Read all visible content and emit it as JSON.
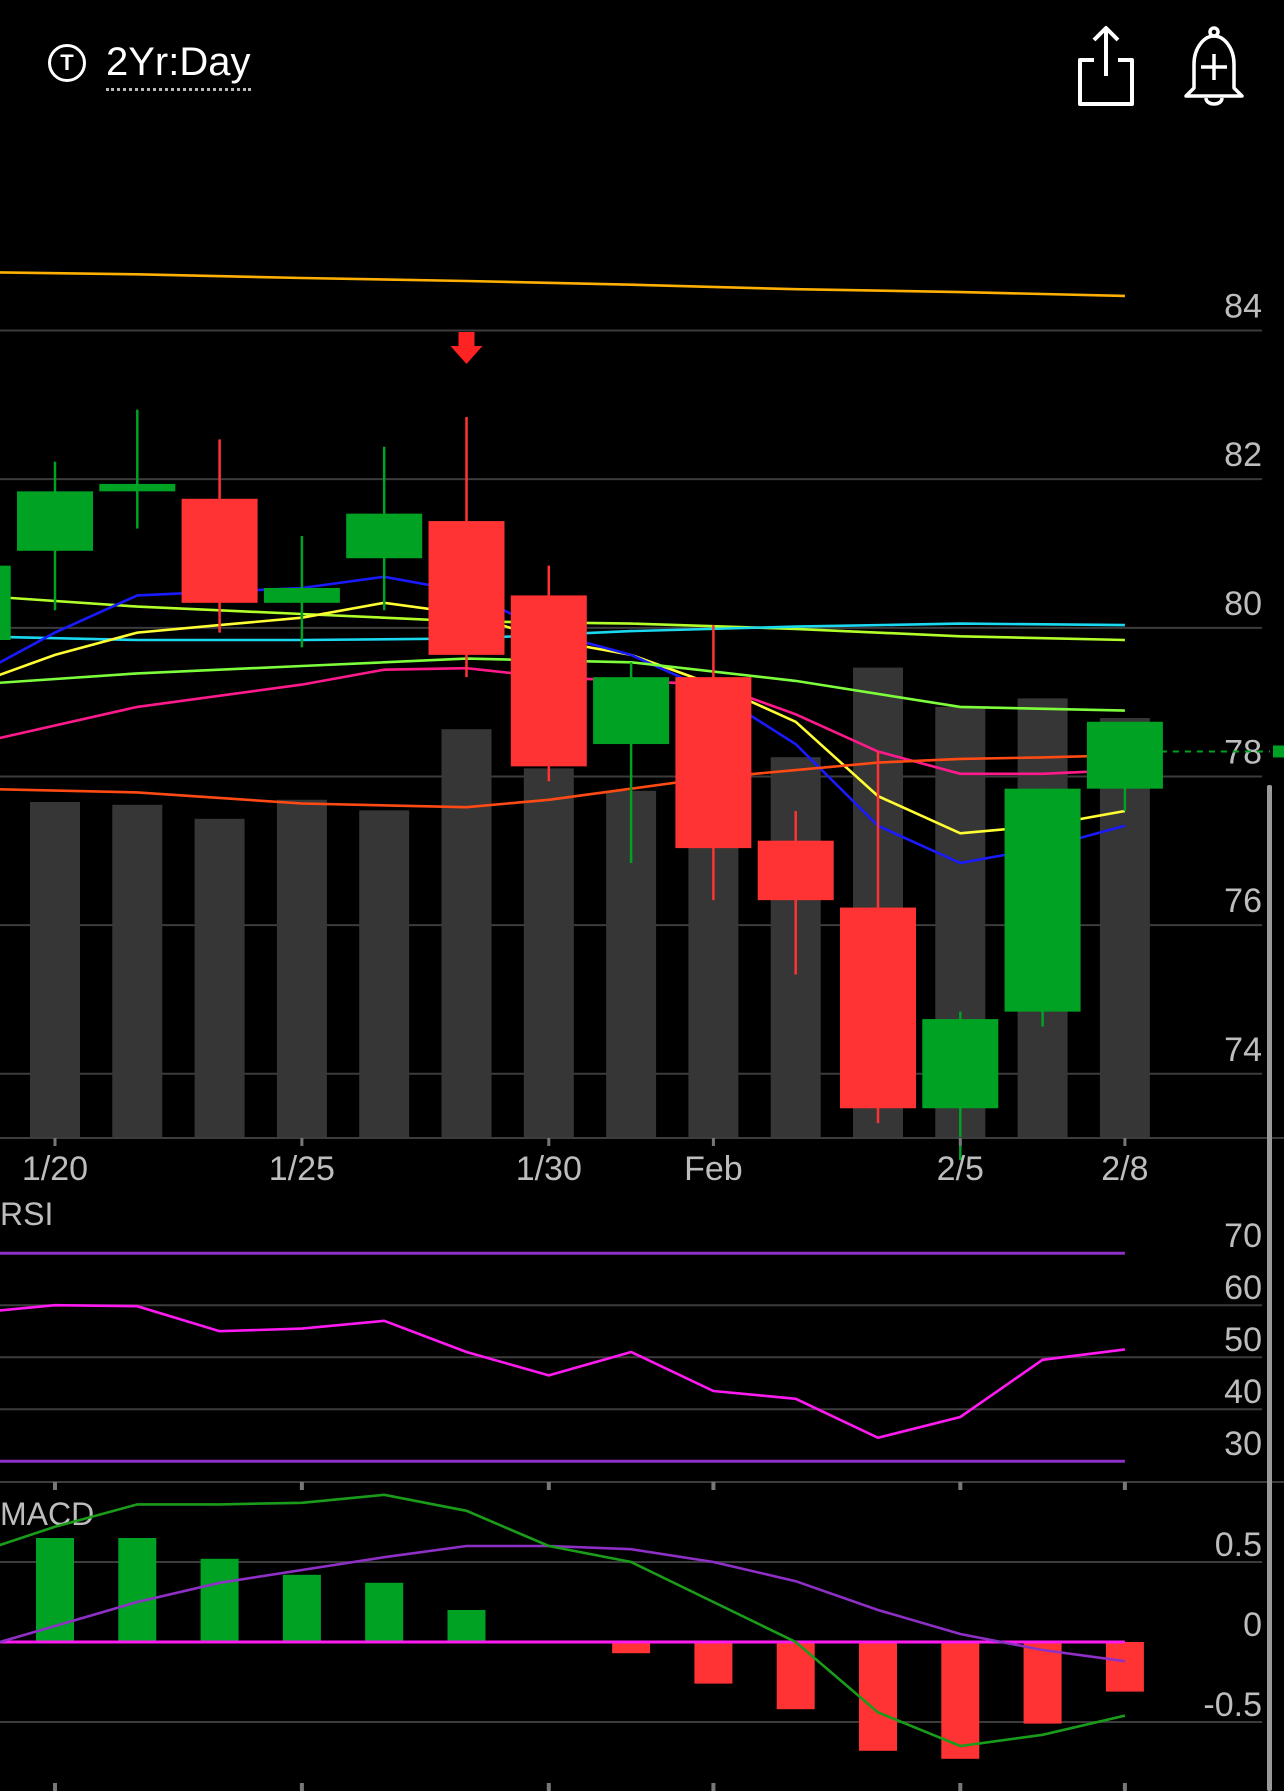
{
  "header": {
    "timeframe_icon": "T",
    "timeframe": "2Yr:Day",
    "share_icon": "share-icon",
    "alert_icon": "bell-plus-icon"
  },
  "colors": {
    "up": "#00a223",
    "down": "#ff3333",
    "volume": "#363636",
    "grid": "#3c3c3c",
    "rsi_line": "#ff1af2",
    "rsi_bands": "#8e2fc6",
    "macd_line": "#1a9c1a",
    "macd_signal": "#8e2fc6",
    "macd_zero": "#ff1af2"
  },
  "chart_data": [
    {
      "type": "candlestick",
      "title": "",
      "x_tick_labels": [
        {
          "index": 0,
          "label": "1/20"
        },
        {
          "index": 3,
          "label": "1/25"
        },
        {
          "index": 6,
          "label": "1/30"
        },
        {
          "index": 8,
          "label": "Feb"
        },
        {
          "index": 11,
          "label": "2/5"
        },
        {
          "index": 13,
          "label": "2/8"
        }
      ],
      "y_ticks": [
        74,
        76,
        78,
        80,
        82,
        84
      ],
      "ylim": [
        72.8,
        86.2
      ],
      "candles": [
        {
          "x": -1,
          "open": 79.5,
          "high": 80.3,
          "low": 79.2,
          "close": 80.5
        },
        {
          "x": 0,
          "open": 80.7,
          "high": 81.9,
          "low": 79.9,
          "close": 81.5
        },
        {
          "x": 1,
          "open": 81.5,
          "high": 82.6,
          "low": 81.0,
          "close": 81.6
        },
        {
          "x": 2,
          "open": 81.4,
          "high": 82.2,
          "low": 79.6,
          "close": 80.0
        },
        {
          "x": 3,
          "open": 80.0,
          "high": 80.9,
          "low": 79.4,
          "close": 80.2
        },
        {
          "x": 4,
          "open": 80.6,
          "high": 82.1,
          "low": 79.9,
          "close": 81.2
        },
        {
          "x": 5,
          "open": 81.1,
          "high": 82.5,
          "low": 79.0,
          "close": 79.3
        },
        {
          "x": 6,
          "open": 80.1,
          "high": 80.5,
          "low": 77.6,
          "close": 77.8
        },
        {
          "x": 7,
          "open": 78.1,
          "high": 79.2,
          "low": 76.5,
          "close": 79.0
        },
        {
          "x": 8,
          "open": 79.0,
          "high": 79.7,
          "low": 76.0,
          "close": 76.7
        },
        {
          "x": 9,
          "open": 76.8,
          "high": 77.2,
          "low": 75.0,
          "close": 76.0
        },
        {
          "x": 10,
          "open": 75.9,
          "high": 78.0,
          "low": 73.0,
          "close": 73.2
        },
        {
          "x": 11,
          "open": 73.2,
          "high": 74.5,
          "low": 72.5,
          "close": 74.4
        },
        {
          "x": 12,
          "open": 74.5,
          "high": 77.5,
          "low": 74.3,
          "close": 77.5
        },
        {
          "x": 13,
          "open": 77.5,
          "high": 78.2,
          "low": 77.2,
          "close": 78.4
        }
      ],
      "signal_arrow": {
        "index": 5,
        "direction": "down"
      },
      "volume": [
        {
          "x": 0,
          "value": 0.6
        },
        {
          "x": 1,
          "value": 0.595
        },
        {
          "x": 2,
          "value": 0.57
        },
        {
          "x": 3,
          "value": 0.604
        },
        {
          "x": 4,
          "value": 0.585
        },
        {
          "x": 5,
          "value": 0.73
        },
        {
          "x": 6,
          "value": 0.66
        },
        {
          "x": 7,
          "value": 0.62
        },
        {
          "x": 8,
          "value": 0.74
        },
        {
          "x": 9,
          "value": 0.68
        },
        {
          "x": 10,
          "value": 0.84
        },
        {
          "x": 11,
          "value": 0.77
        },
        {
          "x": 12,
          "value": 0.785
        },
        {
          "x": 13,
          "value": 0.75
        }
      ],
      "moving_averages": [
        {
          "color": "#ffb000",
          "points": [
            [
              -1,
              84.45
            ],
            [
              1,
              84.42
            ],
            [
              3,
              84.37
            ],
            [
              5,
              84.33
            ],
            [
              7,
              84.28
            ],
            [
              9,
              84.22
            ],
            [
              11,
              84.18
            ],
            [
              13,
              84.13
            ]
          ]
        },
        {
          "color": "#b2ff2a",
          "points": [
            [
              -1,
              80.1
            ],
            [
              1,
              79.95
            ],
            [
              3,
              79.85
            ],
            [
              5,
              79.75
            ],
            [
              7,
              79.72
            ],
            [
              9,
              79.65
            ],
            [
              11,
              79.55
            ],
            [
              13,
              79.5
            ]
          ]
        },
        {
          "color": "#19d8f0",
          "points": [
            [
              -1,
              79.55
            ],
            [
              1,
              79.5
            ],
            [
              3,
              79.5
            ],
            [
              5,
              79.52
            ],
            [
              7,
              79.62
            ],
            [
              9,
              79.68
            ],
            [
              11,
              79.72
            ],
            [
              13,
              79.7
            ]
          ]
        },
        {
          "color": "#ffff33",
          "points": [
            [
              -1,
              78.9
            ],
            [
              0,
              79.3
            ],
            [
              1,
              79.6
            ],
            [
              2,
              79.7
            ],
            [
              3,
              79.8
            ],
            [
              4,
              80.0
            ],
            [
              5,
              79.85
            ],
            [
              6,
              79.5
            ],
            [
              7,
              79.3
            ],
            [
              8,
              78.9
            ],
            [
              9,
              78.4
            ],
            [
              10,
              77.4
            ],
            [
              11,
              76.9
            ],
            [
              12,
              77.0
            ],
            [
              13,
              77.2
            ]
          ]
        },
        {
          "color": "#1a1aff",
          "points": [
            [
              -1,
              79.0
            ],
            [
              0,
              79.6
            ],
            [
              1,
              80.1
            ],
            [
              2,
              80.15
            ],
            [
              3,
              80.2
            ],
            [
              4,
              80.35
            ],
            [
              5,
              80.15
            ],
            [
              6,
              79.6
            ],
            [
              7,
              79.3
            ],
            [
              8,
              78.8
            ],
            [
              9,
              78.1
            ],
            [
              10,
              77.0
            ],
            [
              11,
              76.5
            ],
            [
              12,
              76.7
            ],
            [
              13,
              77.0
            ]
          ]
        },
        {
          "color": "#7dff3c",
          "points": [
            [
              -1,
              78.9
            ],
            [
              1,
              79.05
            ],
            [
              3,
              79.15
            ],
            [
              5,
              79.25
            ],
            [
              7,
              79.2
            ],
            [
              9,
              78.95
            ],
            [
              11,
              78.6
            ],
            [
              13,
              78.55
            ]
          ]
        },
        {
          "color": "#ff1a8c",
          "points": [
            [
              -1,
              78.1
            ],
            [
              1,
              78.6
            ],
            [
              3,
              78.9
            ],
            [
              4,
              79.1
            ],
            [
              5,
              79.12
            ],
            [
              6,
              79.0
            ],
            [
              7,
              78.95
            ],
            [
              8,
              78.9
            ],
            [
              9,
              78.5
            ],
            [
              10,
              78.0
            ],
            [
              11,
              77.7
            ],
            [
              12,
              77.7
            ],
            [
              13,
              77.75
            ]
          ]
        },
        {
          "color": "#ff4a14",
          "points": [
            [
              -1,
              77.5
            ],
            [
              1,
              77.45
            ],
            [
              3,
              77.3
            ],
            [
              5,
              77.25
            ],
            [
              6,
              77.35
            ],
            [
              7,
              77.5
            ],
            [
              8,
              77.65
            ],
            [
              9,
              77.75
            ],
            [
              10,
              77.85
            ],
            [
              11,
              77.9
            ],
            [
              12,
              77.92
            ],
            [
              13,
              77.95
            ]
          ]
        }
      ],
      "last_price_marker": 78.0
    },
    {
      "type": "line",
      "title": "RSI",
      "y_ticks": [
        30,
        40,
        50,
        60,
        70
      ],
      "ylim": [
        26,
        76
      ],
      "bands": [
        30,
        70
      ],
      "x": [
        -1,
        0,
        1,
        2,
        3,
        4,
        5,
        6,
        7,
        8,
        9,
        10,
        11,
        12,
        13
      ],
      "values": [
        58.5,
        60,
        59.8,
        55,
        55.5,
        57,
        51,
        46.5,
        51,
        43.5,
        42,
        34.5,
        38.5,
        49.5,
        51.5
      ]
    },
    {
      "type": "bar+line",
      "title": "MACD",
      "y_ticks": [
        0.5,
        0,
        -0.5
      ],
      "ylim": [
        -0.85,
        0.85
      ],
      "histogram": [
        {
          "x": 0,
          "value": 0.65
        },
        {
          "x": 1,
          "value": 0.65
        },
        {
          "x": 2,
          "value": 0.52
        },
        {
          "x": 3,
          "value": 0.42
        },
        {
          "x": 4,
          "value": 0.37
        },
        {
          "x": 5,
          "value": 0.2
        },
        {
          "x": 6,
          "value": 0.0
        },
        {
          "x": 7,
          "value": -0.07
        },
        {
          "x": 8,
          "value": -0.26
        },
        {
          "x": 9,
          "value": -0.42
        },
        {
          "x": 10,
          "value": -0.68
        },
        {
          "x": 11,
          "value": -0.73
        },
        {
          "x": 12,
          "value": -0.51
        },
        {
          "x": 13,
          "value": -0.31
        }
      ],
      "macd_line": [
        [
          -1,
          0.55
        ],
        [
          0,
          0.72
        ],
        [
          1,
          0.86
        ],
        [
          2,
          0.86
        ],
        [
          3,
          0.87
        ],
        [
          4,
          0.92
        ],
        [
          5,
          0.82
        ],
        [
          6,
          0.6
        ],
        [
          7,
          0.5
        ],
        [
          8,
          0.25
        ],
        [
          9,
          0.0
        ],
        [
          10,
          -0.44
        ],
        [
          11,
          -0.65
        ],
        [
          12,
          -0.58
        ],
        [
          13,
          -0.46
        ]
      ],
      "signal_line": [
        [
          -1,
          -0.05
        ],
        [
          0,
          0.1
        ],
        [
          1,
          0.25
        ],
        [
          2,
          0.37
        ],
        [
          3,
          0.45
        ],
        [
          4,
          0.53
        ],
        [
          5,
          0.6
        ],
        [
          6,
          0.6
        ],
        [
          7,
          0.58
        ],
        [
          8,
          0.5
        ],
        [
          9,
          0.38
        ],
        [
          10,
          0.2
        ],
        [
          11,
          0.05
        ],
        [
          12,
          -0.05
        ],
        [
          13,
          -0.12
        ]
      ]
    }
  ]
}
